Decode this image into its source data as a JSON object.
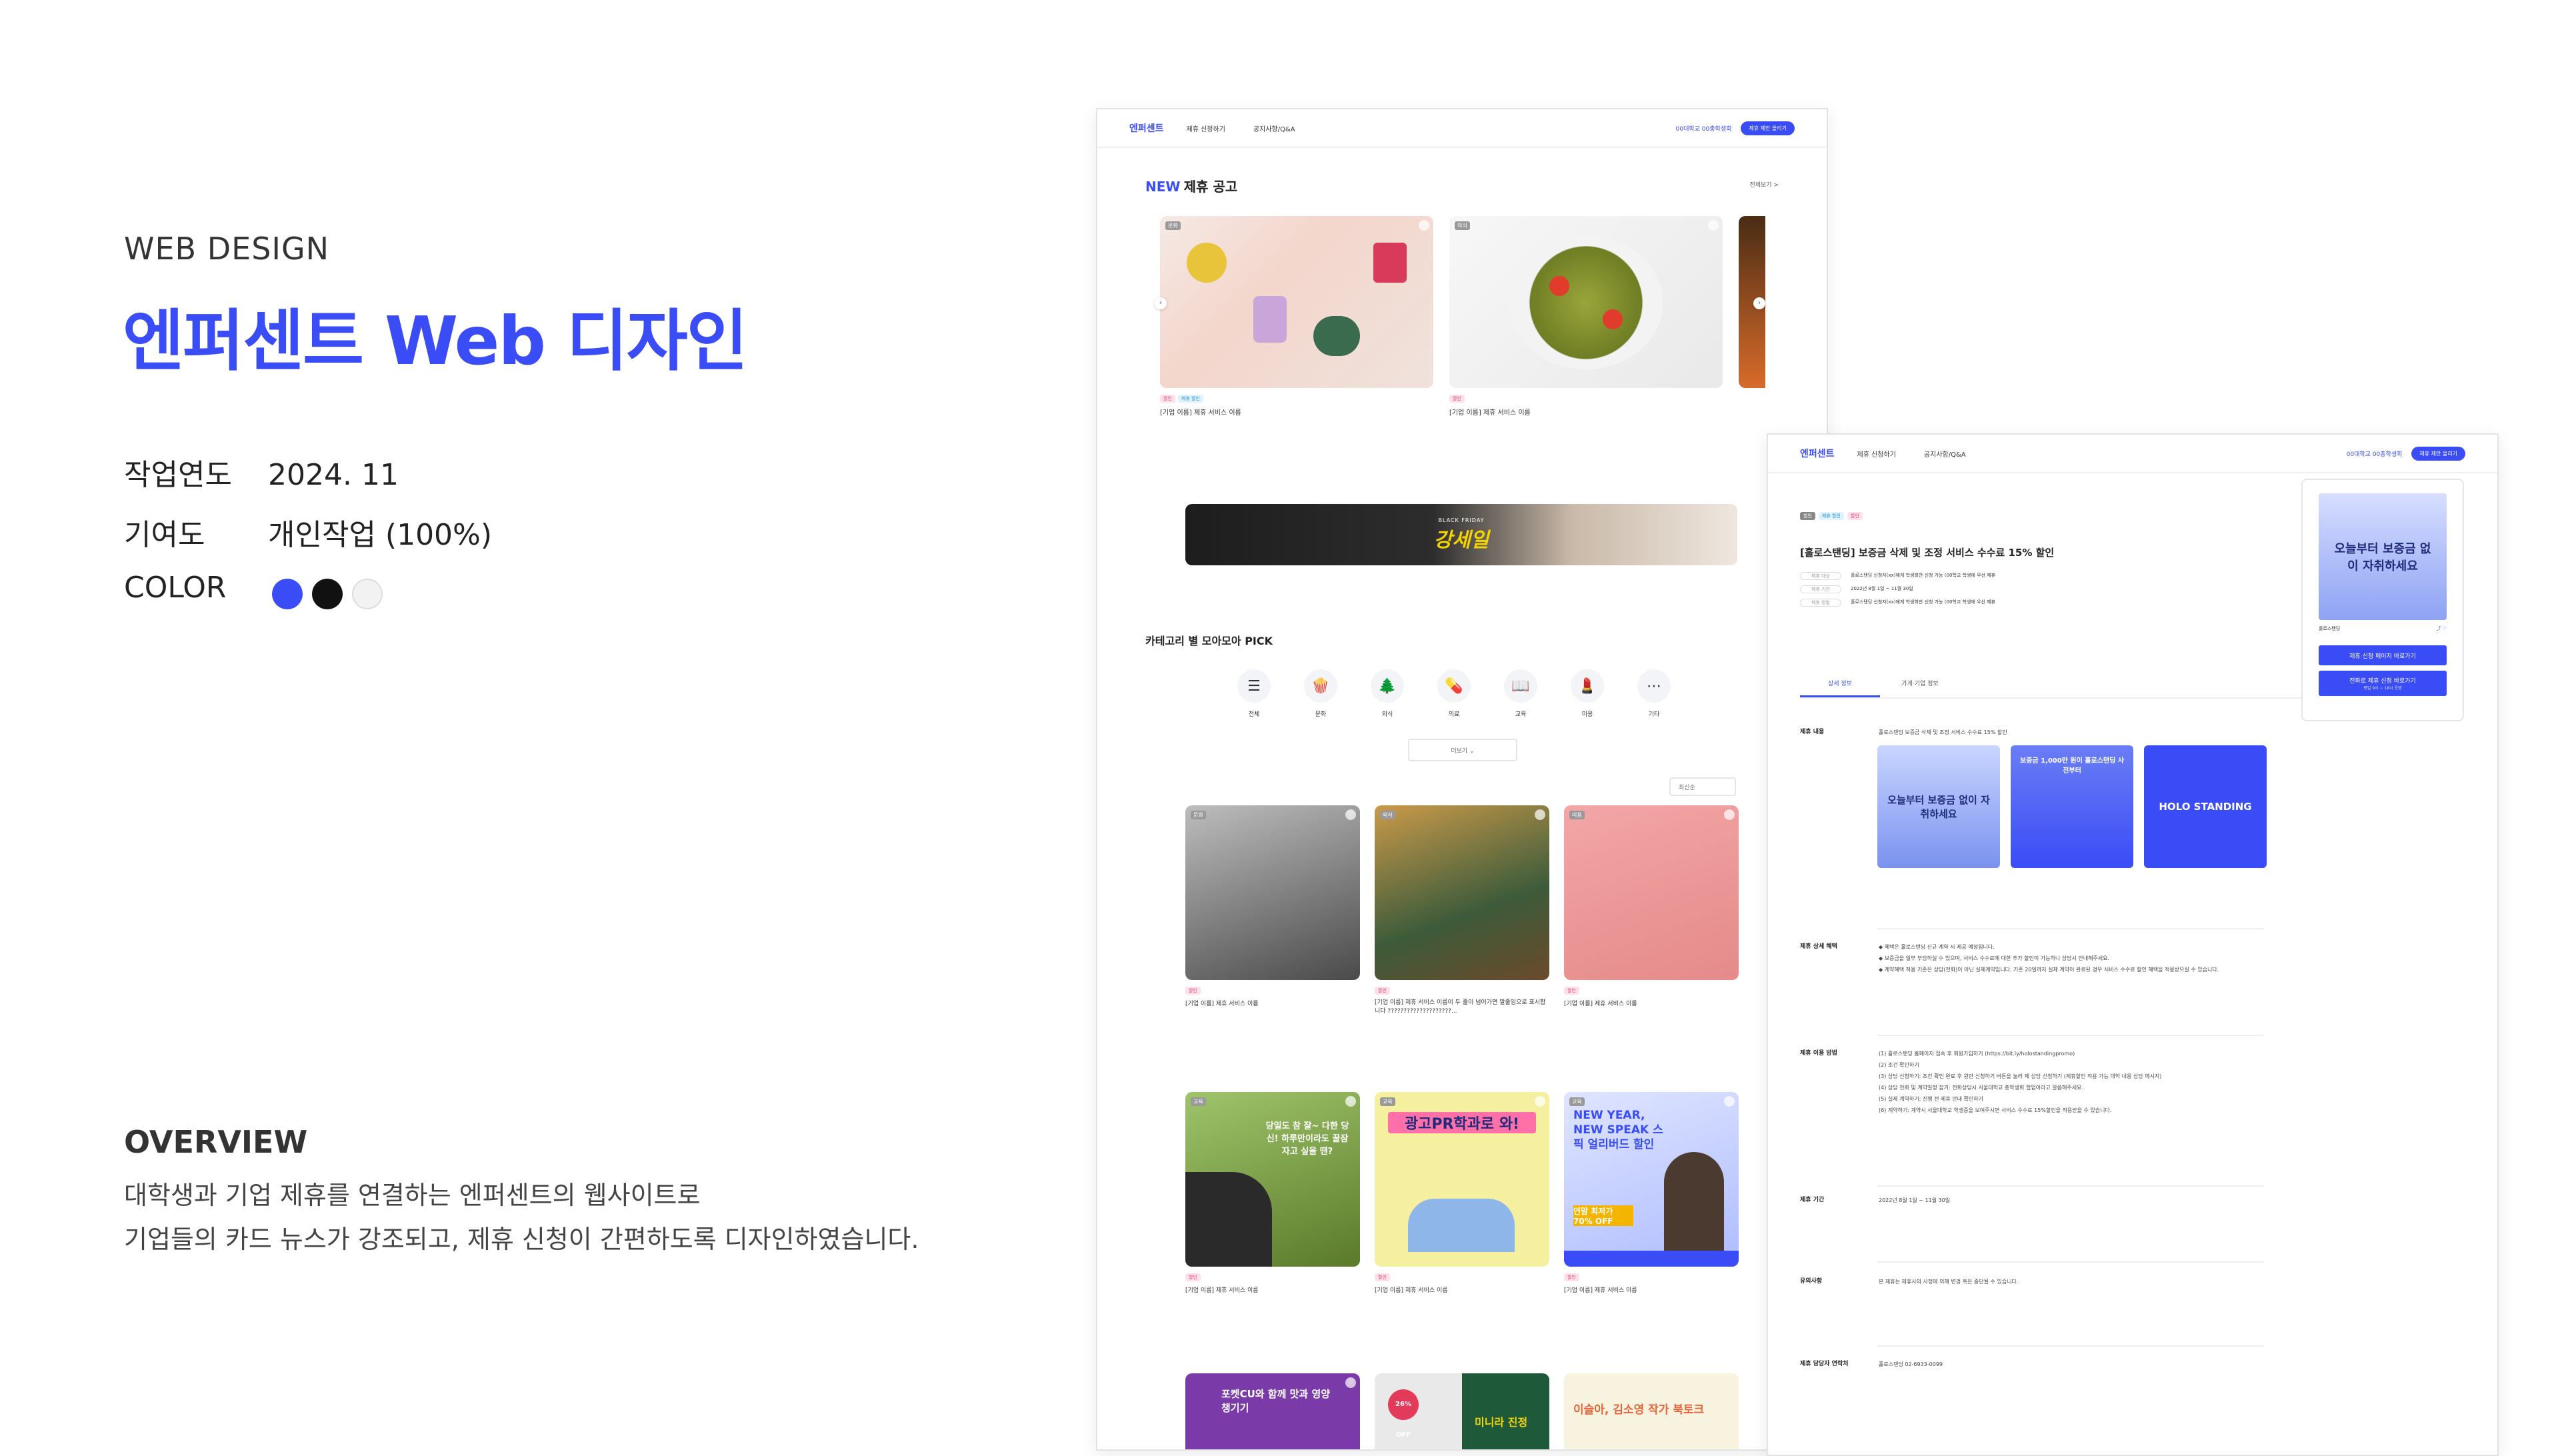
{
  "portfolio": {
    "category": "WEB DESIGN",
    "title": "엔퍼센트 Web 디자인",
    "info": [
      {
        "key": "작업연도",
        "value": "2024. 11"
      },
      {
        "key": "기여도",
        "value": "개인작업 (100%)"
      },
      {
        "key": "COLOR",
        "value": ""
      }
    ],
    "colors": [
      "#3a4cf5",
      "#111111",
      "#f2f2f2"
    ],
    "overview_title": "OVERVIEW",
    "overview_lines": [
      "대학생과 기업 제휴를 연결하는 엔퍼센트의 웹사이트로",
      "기업들의 카드 뉴스가 강조되고, 제휴 신청이 간편하도록 디자인하였습니다."
    ]
  },
  "site": {
    "logo": "엔퍼센트",
    "nav": [
      "제휴 신청하기",
      "공지사항/Q&A"
    ],
    "login_text": "00대학교 00총학생회",
    "nav_button": "제휴 제안 올리기"
  },
  "home": {
    "new_section_prefix": "NEW",
    "new_section_title": "제휴 공고",
    "view_all": "전체보기 >",
    "new_cards": [
      {
        "tag": "문화",
        "chips": [
          "할인",
          "제휴 할인"
        ],
        "title": "[기업 이름] 제휴 서비스 이름"
      },
      {
        "tag": "외식",
        "chips": [
          "할인"
        ],
        "title": "[기업 이름] 제휴 서비스 이름"
      }
    ],
    "banner_small": "BLACK FRIDAY",
    "banner_big": "강세일",
    "category_title": "카테고리 별 모아모아 PICK",
    "categories": [
      {
        "label": "전체",
        "icon": "list-icon",
        "glyph": "☰"
      },
      {
        "label": "문화",
        "icon": "popcorn-icon",
        "glyph": "🍿"
      },
      {
        "label": "외식",
        "icon": "tree-icon",
        "glyph": "🌲"
      },
      {
        "label": "의료",
        "icon": "pill-icon",
        "glyph": "💊"
      },
      {
        "label": "교육",
        "icon": "book-icon",
        "glyph": "📖"
      },
      {
        "label": "미용",
        "icon": "beauty-icon",
        "glyph": "💄"
      },
      {
        "label": "기타",
        "icon": "more-icon",
        "glyph": "⋯"
      }
    ],
    "more_button": "더보기 ⌄",
    "sort": "최신순",
    "grid_cards": [
      {
        "tag": "문화",
        "chips": [
          "할인"
        ],
        "title": "[기업 이름] 제휴 서비스 이름"
      },
      {
        "tag": "외식",
        "chips": [
          "할인"
        ],
        "title": "[기업 이름] 제휴 서비스 이름이 두 줄이 넘어가면 말줄임으로 표시합니다 ????????????????????..."
      },
      {
        "tag": "미용",
        "chips": [
          "할인"
        ],
        "title": "[기업 이름] 제휴 서비스 이름"
      },
      {
        "tag": "교육",
        "chips": [
          "할인"
        ],
        "title": "[기업 이름] 제휴 서비스 이름"
      },
      {
        "tag": "교육",
        "chips": [
          "할인"
        ],
        "title": "[기업 이름] 제휴 서비스 이름"
      },
      {
        "tag": "교육",
        "chips": [
          "할인"
        ],
        "title": "[기업 이름] 제휴 서비스 이름"
      }
    ],
    "card_texts": [
      "당일도 참 잘~ 다한 당신! 하루만이라도 꿀잠 자고 싶을 땐?",
      "광고PR학과로 와!",
      "NEW YEAR, NEW SPEAK 스픽 얼리버드 할인",
      "연말 최저가 70% OFF",
      "포켓CU와 함께 맛과 영양 챙기기",
      "26% OFF",
      "미니라 진정",
      "이슬아, 김소영 작가 북토크"
    ]
  },
  "detail": {
    "chips": [
      "할인",
      "제휴 할인",
      "할인"
    ],
    "title": "[홀로스탠딩] 보증금 삭제 및 조정 서비스 수수료 15% 할인",
    "meta": [
      {
        "key": "제휴 대상",
        "value": "홀로스탠딩 신청자(xx)에게 학생회만 신청 가능 (00학교 학생에 우선 제휴"
      },
      {
        "key": "제휴 기간",
        "value": "2022년 8월 1일 ~ 11월 30일"
      },
      {
        "key": "제휴 방법",
        "value": "홀로스탠딩 신청자(xx)에게 학생회만 신청 가능 (00학교 학생에 우선 제휴"
      }
    ],
    "tabs": [
      "상세 정보",
      "가게·기업 정보"
    ],
    "content_title": "홀로스탠딩 보증금 삭제 및 조정 서비스 수수료 15% 할인",
    "poster_text": "오늘부터 보증금 없이 자취하세요",
    "poster2_text": "보증금 1,000만 원이 홀로스탠딩 사전부터",
    "brand": "HOLO STANDING",
    "sections": [
      {
        "key": "제휴 내용",
        "lines": [
          "홀로스탠딩 보증금 삭제 및 조정 서비스 수수료 15% 할인"
        ]
      },
      {
        "key": "제휴 상세 혜택",
        "lines": [
          "◆ 혜택은 홀로스탠딩 신규 계약 시 제공 예정입니다.",
          "◆ 보증금을 일부 부담하실 수 있으며, 서비스 수수료에 대한 추가 할인이 가능하니 상담시 안내해주세요.",
          "◆ 계약혜택 적용 기준은 상담(전화)이 아닌 실제계약입니다. 기존 20일까지 실제 계약이 완료된 경우 서비스 수수료 할인 혜택을 적용받으실 수 있습니다."
        ]
      },
      {
        "key": "제휴 이용 방법",
        "lines": [
          "(1) 홀로스탠딩 홈페이지 접속 후 회원가입하기 (https://bit.ly/holostandingpromo)",
          "(2) 조건 확인하기",
          "(3) 상담 신청하기: 조건 확인 완료 후 원만 신청하기 버튼을 눌러 제 상담 신청하기 (제휴할인 적용 가능 대학 내용 상담 메시지)",
          "(4) 상담 전화 및 계약일정 잡기: 전화상담시 서울대학교 총학생회 협업이라고 말씀해주세요.",
          "(5) 실제 계약하기: 진행 전 제휴 안내 확인하기",
          "(6) 계약하기: 계약시 서울대학교 학생증을 보여주시면 서비스 수수료 15%할인을 적용받을 수 있습니다."
        ]
      },
      {
        "key": "제휴 기간",
        "lines": [
          "2022년 8월 1일 ~ 11월 30일"
        ]
      },
      {
        "key": "유의사항",
        "lines": [
          "본 제휴는 제휴사의 사정에 의해 변경 혹은 중단될 수 있습니다."
        ]
      },
      {
        "key": "제휴 담당자 연락처",
        "lines": [
          "홀로스탠딩 02-6933-0099"
        ]
      }
    ],
    "side_poster_text": "오늘부터 보증금 없이 자취하세요",
    "side_brand": "홀로스탠딩",
    "side_btn1": "제휴 신청 페이지 바로가기",
    "side_btn2": "전화로 제휴 신청 바로가기",
    "side_btn2_sub": "평일 9시 ~ 18시 운영"
  }
}
